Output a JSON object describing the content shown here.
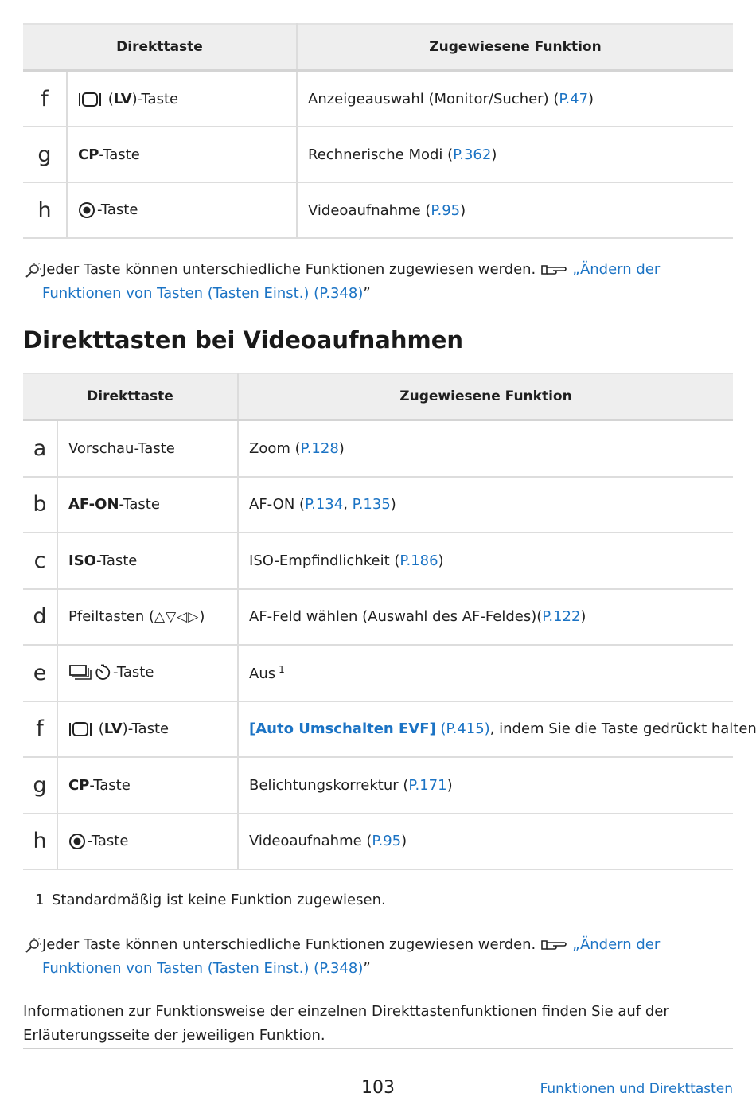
{
  "table_headers": {
    "key": "Direkttaste",
    "function": "Zugewiesene Funktion"
  },
  "table1_rows": [
    {
      "letter": "f",
      "icon": "display-toggle-icon",
      "key_pre": "",
      "key_bold": "LV",
      "key_post": ")-Taste",
      "key_open": " (",
      "func_text": "Anzeigeauswahl (Monitor/Sucher) (",
      "func_ref": "P.47",
      "func_end": ")"
    },
    {
      "letter": "g",
      "icon": "",
      "key_bold": "CP",
      "key_post": "-Taste",
      "func_text": "Rechnerische Modi (",
      "func_ref": "P.362",
      "func_end": ")"
    },
    {
      "letter": "h",
      "icon": "record-icon",
      "key_bold": "",
      "key_post": "-Taste",
      "func_text": "Videoaufnahme (",
      "func_ref": "P.95",
      "func_end": ")"
    }
  ],
  "tip": {
    "text": "Jeder Taste können unterschiedliche Funktionen zugewiesen werden.",
    "link": "„Ändern der Funktionen von Tasten (Tasten Einst.) (P.348)",
    "close": "”"
  },
  "section_title": "Direkttasten bei Videoaufnahmen",
  "table2_rows": [
    {
      "letter": "a",
      "key_plain": "Vorschau-Taste",
      "func_text": "Zoom (",
      "func_ref": "P.128",
      "func_end": ")"
    },
    {
      "letter": "b",
      "key_bold": "AF-ON",
      "key_post": "-Taste",
      "func_text": "AF-ON (",
      "func_ref": "P.134",
      "func_sep": ", ",
      "func_ref2": "P.135",
      "func_end": ")"
    },
    {
      "letter": "c",
      "key_bold": "ISO",
      "key_post": "-Taste",
      "func_text": "ISO-Empfindlichkeit (",
      "func_ref": "P.186",
      "func_end": ")"
    },
    {
      "letter": "d",
      "key_plain": "Pfeiltasten (",
      "key_post": ")",
      "arrows": "△▽◁▷",
      "func_text": "AF-Feld wählen (Auswahl des AF-Feldes)(",
      "func_ref": "P.122",
      "func_end": ")"
    },
    {
      "letter": "e",
      "key_post": "-Taste",
      "func_text": "Aus",
      "func_sup": "1"
    },
    {
      "letter": "f",
      "key_open": " (",
      "key_bold": "LV",
      "key_post": ")-Taste",
      "func_bold_link": "[Auto Umschalten EVF]",
      "func_ref": "(P.415)",
      "func_end": ", indem Sie die Taste gedrückt halten."
    },
    {
      "letter": "g",
      "key_bold": "CP",
      "key_post": "-Taste",
      "func_text": "Belichtungskorrektur (",
      "func_ref": "P.171",
      "func_end": ")"
    },
    {
      "letter": "h",
      "key_post": "-Taste",
      "func_text": "Videoaufnahme (",
      "func_ref": "P.95",
      "func_end": ")"
    }
  ],
  "footnote": {
    "num": "1",
    "text": "Standardmäßig ist keine Funktion zugewiesen."
  },
  "info": "Informationen zur Funktionsweise der einzelnen Direkttastenfunktionen finden Sie auf der Erläuterungsseite der jeweiligen Funktion.",
  "footer": {
    "page": "103",
    "title": "Funktionen und Direkttasten"
  }
}
